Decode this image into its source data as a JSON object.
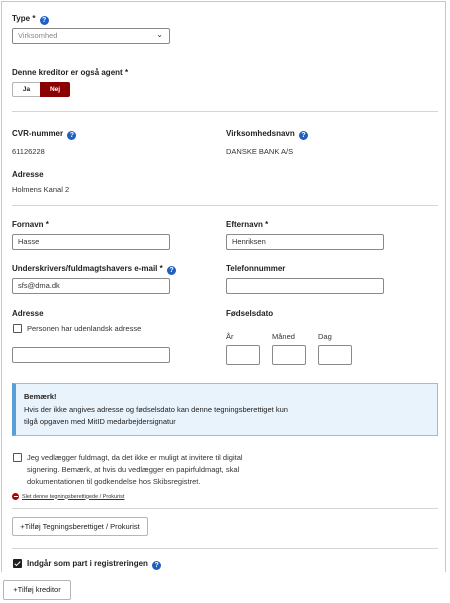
{
  "type_field": {
    "label": "Type",
    "required": "*",
    "value": "Virksomhed"
  },
  "agent": {
    "label": "Denne kreditor er også agent",
    "required": "*",
    "yes": "Ja",
    "no": "Nej"
  },
  "cvr": {
    "label": "CVR-nummer",
    "value": "61126228"
  },
  "company": {
    "label": "Virksomhedsnavn",
    "value": "DANSKE BANK A/S"
  },
  "address_top": {
    "label": "Adresse",
    "value": "Holmens Kanal 2"
  },
  "firstname": {
    "label": "Fornavn",
    "required": "*",
    "value": "Hasse"
  },
  "lastname": {
    "label": "Efternavn",
    "required": "*",
    "value": "Henriksen"
  },
  "email": {
    "label": "Underskrivers/fuldmagtshavers e-mail",
    "required": "*",
    "value": "sfs@dma.dk"
  },
  "phone": {
    "label": "Telefonnummer",
    "value": ""
  },
  "address": {
    "label": "Adresse",
    "foreign_label": "Personen har udenlandsk adresse",
    "value": ""
  },
  "birthdate": {
    "label": "Fødselsdato",
    "year": "År",
    "month": "Måned",
    "day": "Dag"
  },
  "notice": {
    "title": "Bemærk!",
    "line1": "Hvis der ikke angives adresse og fødselsdato kan denne tegningsberettiget kun",
    "line2": "tilgå opgaven med MitID medarbejdersignatur"
  },
  "attach": {
    "line1": "Jeg vedlægger fuldmagt, da det ikke er muligt at invitere til digital",
    "line2": "signering. Bemærk, at hvis du vedlægger en papirfuldmagt, skal",
    "line3": "dokumentationen til godkendelse hos Skibsregistret."
  },
  "delete_link": "Slet denne tegningsberettigede / Prokurist",
  "add_signatory": "+Tilføj Tegningsberettiget / Prokurist",
  "include": {
    "label": "Indgår som part i registreringen",
    "checked": true
  },
  "add_creditor": "+Tilføj kreditor",
  "colors": {
    "accent": "#8b0000",
    "help": "#1f5fbf",
    "notice_border": "#5aa0d8",
    "notice_bg": "#e9f3fb",
    "delete": "#b00000"
  },
  "icons": [
    "help-icon",
    "chevron-down-icon",
    "minus-circle-icon",
    "checkmark-icon"
  ]
}
